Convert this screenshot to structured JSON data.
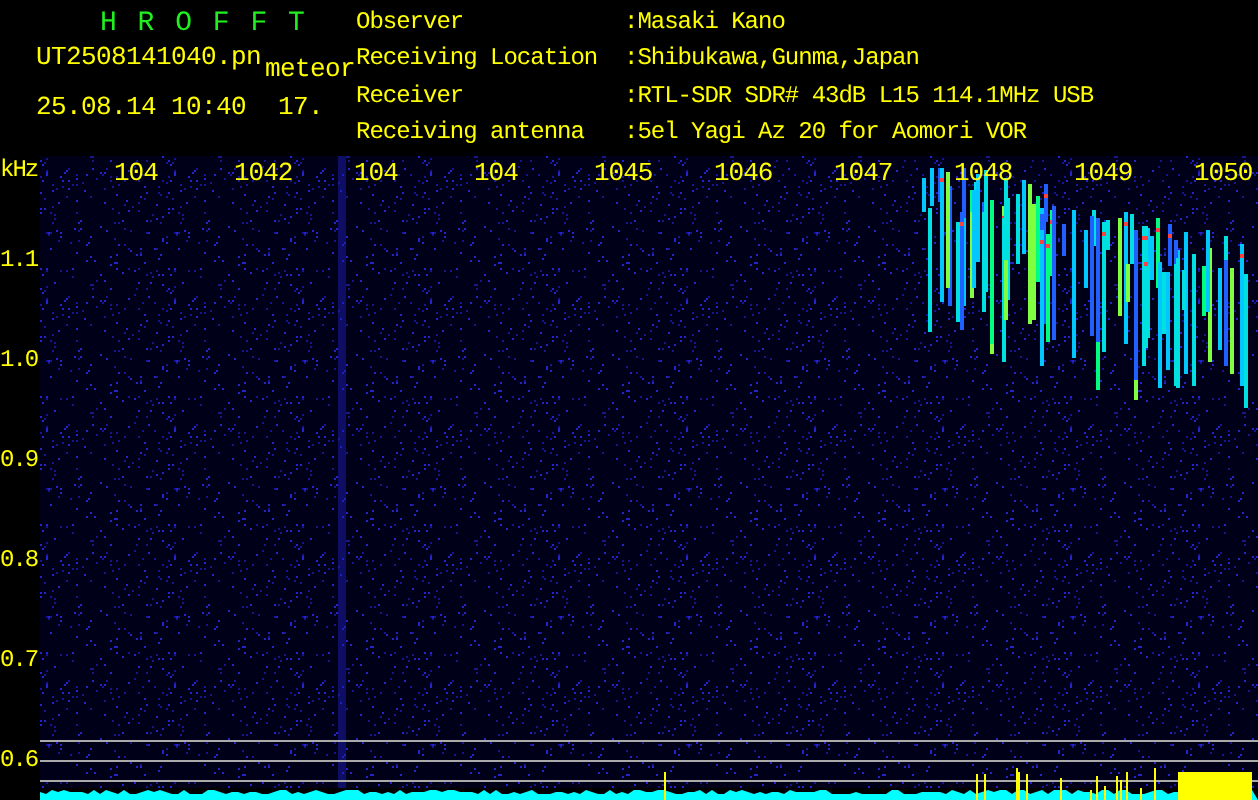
{
  "header": {
    "title": "H R O F F T",
    "file_name": "UT2508141040.pn",
    "tag": "meteor",
    "date_time": "25.08.14 10:40",
    "count": "17.",
    "info": [
      {
        "label": "Observer",
        "value": ":Masaki Kano"
      },
      {
        "label": "Receiving Location",
        "value": ":Shibukawa,Gunma,Japan"
      },
      {
        "label": "Receiver",
        "value": ":RTL-SDR SDR# 43dB L15 114.1MHz USB"
      },
      {
        "label": "Receiving antenna",
        "value": ":5el Yagi Az 20 for Aomori VOR"
      }
    ]
  },
  "spectrogram": {
    "unit": "kHz",
    "y_labels": [
      "1.1",
      "1.0",
      "0.9",
      "0.8",
      "0.7",
      "0.6"
    ],
    "time_labels": [
      "104",
      "1042",
      "104",
      "104",
      "1045",
      "1046",
      "1047",
      "1048",
      "1049",
      "1050"
    ]
  }
}
